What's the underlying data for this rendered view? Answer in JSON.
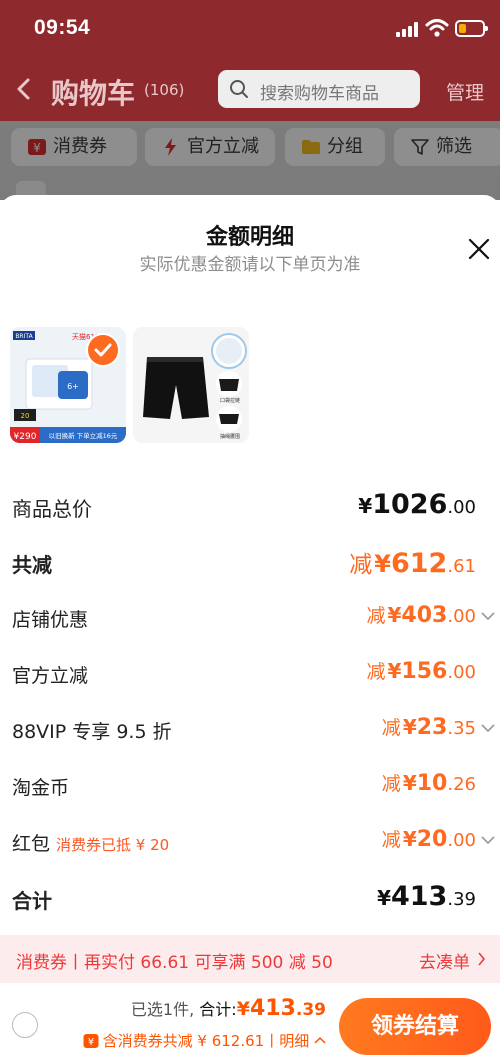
{
  "status_bar": {
    "time": "09:54"
  },
  "nav": {
    "title": "购物车",
    "count": "(106)",
    "search_placeholder": "搜索购物车商品",
    "manage": "管理"
  },
  "chips": [
    {
      "label": "消费券",
      "icon": "coupon-icon"
    },
    {
      "label": "官方立减",
      "icon": "lightning-icon"
    },
    {
      "label": "分组",
      "icon": "folder-icon"
    },
    {
      "label": "筛选",
      "icon": "filter-icon"
    }
  ],
  "sheet": {
    "title": "金额明细",
    "subtitle": "实际优惠金额请以下单页为准",
    "products": [
      {
        "name": "BRITA 滤芯",
        "tag": "天猫618",
        "badge": "6+",
        "price_tag": "¥290",
        "promo": "以旧换新 下单立减16元",
        "count_badge": "20",
        "selected": true
      },
      {
        "name": "运动短裤",
        "labels": [
          "口袋拉链",
          "抽绳腰围"
        ]
      }
    ],
    "rows": [
      {
        "label": "商品总价",
        "currency": "¥",
        "int": "1026",
        "dec": ".00"
      },
      {
        "label": "共减",
        "prefix": "减",
        "currency": "¥",
        "int": "612",
        "dec": ".61"
      },
      {
        "label": "店铺优惠",
        "prefix": "减",
        "currency": "¥",
        "int": "403",
        "dec": ".00"
      },
      {
        "label": "官方立减",
        "prefix": "减",
        "currency": "¥",
        "int": "156",
        "dec": ".00"
      },
      {
        "label": "88VIP 专享 9.5 折",
        "prefix": "减",
        "currency": "¥",
        "int": "23",
        "dec": ".35"
      },
      {
        "label": "淘金币",
        "prefix": "减",
        "currency": "¥",
        "int": "10",
        "dec": ".26"
      },
      {
        "label": "红包",
        "sublabel": "消费券已抵 ¥ 20",
        "prefix": "减",
        "currency": "¥",
        "int": "20",
        "dec": ".00"
      },
      {
        "label": "合计",
        "currency": "¥",
        "int": "413",
        "dec": ".39"
      }
    ],
    "coupon_bar": {
      "text": "消费券丨再实付 66.61 可享满 500 减 50",
      "action": "去凑单"
    }
  },
  "footer": {
    "selected": "已选1件,",
    "total_label": "合计:",
    "total_currency": "¥",
    "total_int": "413",
    "total_dec": ".39",
    "coupon_text": "含消费券共减 ¥ 612.61丨",
    "detail": "明细",
    "button": "领券结算"
  },
  "colors": {
    "accent": "#ff6a21",
    "header_dimmed": "#8e2a2e",
    "coupon_bar_bg": "#fdeced",
    "coupon_bar_text": "#ec3a3a"
  }
}
